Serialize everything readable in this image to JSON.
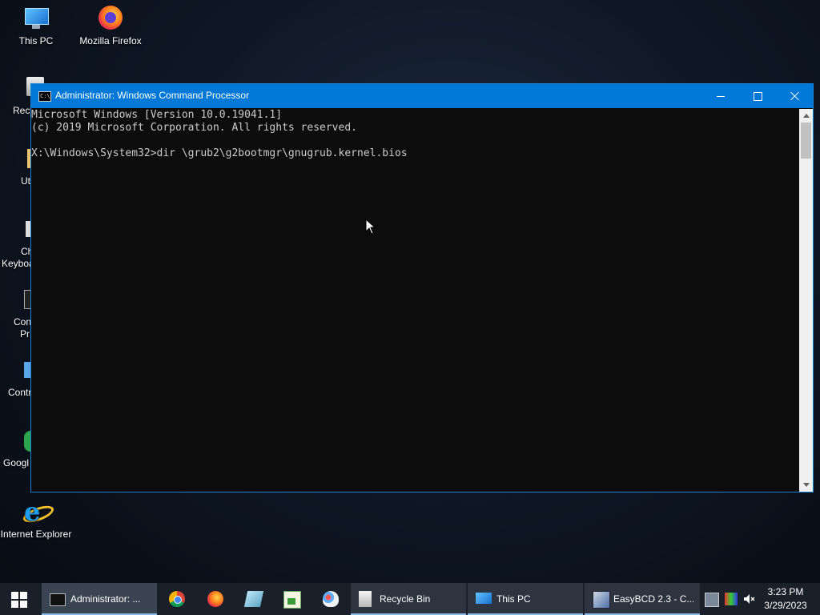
{
  "desktop": {
    "icons": [
      {
        "label": "This PC"
      },
      {
        "label": "Mozilla Firefox"
      },
      {
        "label": "Internet Explorer"
      }
    ],
    "partial_labels": [
      "Recy",
      "Uti",
      "Ch",
      "Keyboa",
      "Con",
      "Pr",
      "Contr",
      "Googl"
    ]
  },
  "window": {
    "title": "Administrator: Windows Command Processor",
    "console_lines": [
      "Microsoft Windows [Version 10.0.19041.1]",
      "(c) 2019 Microsoft Corporation. All rights reserved.",
      "",
      "X:\\Windows\\System32>dir \\grub2\\g2bootmgr\\gnugrub.kernel.bios"
    ],
    "icon_text": "C:\\"
  },
  "taskbar": {
    "items": [
      {
        "label": "Administrator: ..."
      },
      {
        "label": "Recycle Bin"
      },
      {
        "label": "This PC"
      },
      {
        "label": "EasyBCD 2.3 - C..."
      }
    ],
    "pinned": [
      "chrome-icon",
      "firefox-icon",
      "notepad-icon",
      "spreadsheet-icon",
      "paint-icon"
    ],
    "clock": {
      "time": "3:23 PM",
      "date": "3/29/2023"
    }
  },
  "colors": {
    "titlebar": "#0078d7",
    "console_bg": "#0c0c0c",
    "console_text": "#cccccc",
    "taskbar": "#1a2029"
  }
}
